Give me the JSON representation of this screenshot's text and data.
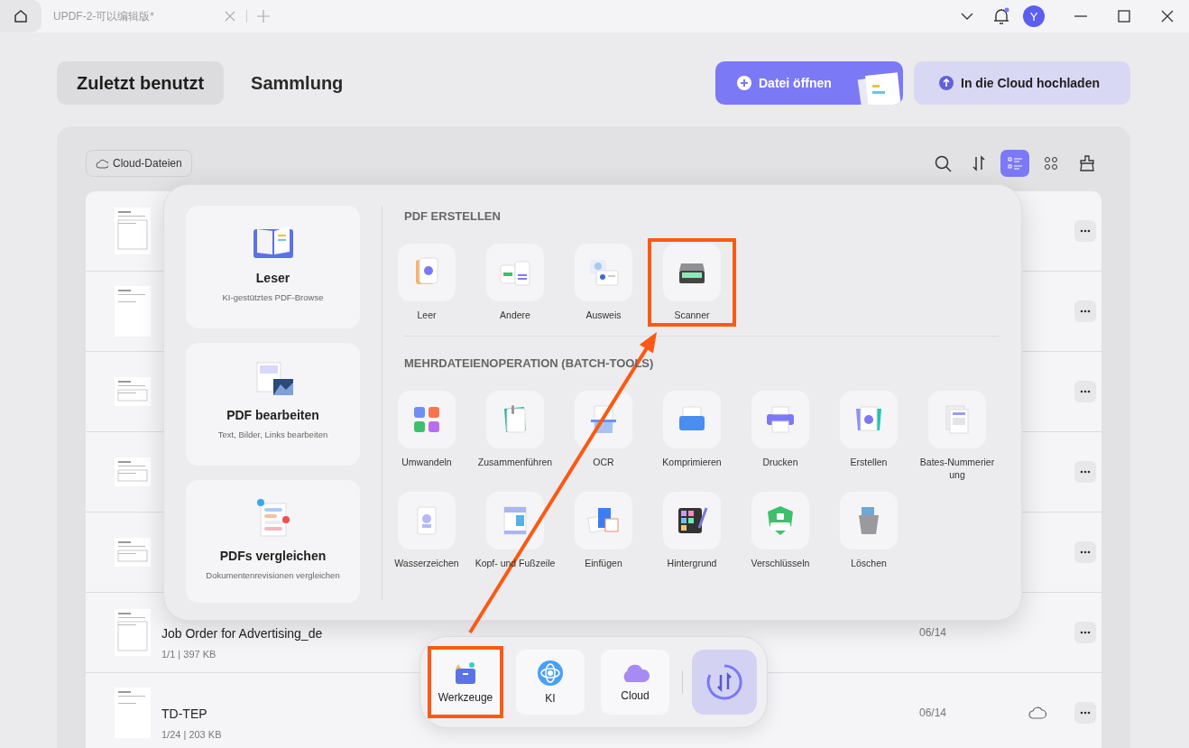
{
  "titlebar": {
    "tab_title": "UPDF-2-可以编辑版*",
    "avatar": "Y"
  },
  "view_tabs": [
    {
      "label": "Zuletzt benutzt",
      "selected": true
    },
    {
      "label": "Sammlung",
      "selected": false
    }
  ],
  "actions": {
    "open": "Datei öffnen",
    "upload": "In die Cloud hochladen"
  },
  "filter_chip": "Cloud-Dateien",
  "toolbar": [
    {
      "kind": "search",
      "selected": false
    },
    {
      "kind": "sort",
      "selected": false
    },
    {
      "kind": "list",
      "selected": true
    },
    {
      "kind": "grid",
      "selected": false
    },
    {
      "kind": "clean",
      "selected": false
    }
  ],
  "files": [
    {
      "kind": "form",
      "cloud": false
    },
    {
      "kind": "text",
      "cloud": false
    },
    {
      "kind": "table",
      "cloud": false
    },
    {
      "kind": "table",
      "cloud": false
    },
    {
      "kind": "table",
      "cloud": false
    },
    {
      "kind": "form",
      "name": "Job Order for Advertising_de",
      "meta": "1/1 | 397 KB",
      "date": "06/14",
      "cloud": false
    },
    {
      "kind": "text",
      "name": "TD-TEP",
      "meta": "1/24 | 203 KB",
      "date": "06/14",
      "cloud": true
    }
  ],
  "tools_popup": {
    "feature_cards": [
      {
        "kind": "reader",
        "title": "Leser",
        "subtitle": "KI-gestütztes PDF-Browse"
      },
      {
        "kind": "edit",
        "title": "PDF bearbeiten",
        "subtitle": "Text, Bilder, Links bearbeiten"
      },
      {
        "kind": "compare",
        "title": "PDFs vergleichen",
        "subtitle": "Dokumentenrevisionen vergleichen"
      }
    ],
    "sections": [
      {
        "title": "PDF ERSTELLEN",
        "items": [
          {
            "kind": "blank",
            "label": "Leer",
            "highlighted": false
          },
          {
            "kind": "other",
            "label": "Andere",
            "highlighted": false
          },
          {
            "kind": "id",
            "label": "Ausweis",
            "highlighted": false
          },
          {
            "kind": "scanner",
            "label": "Scanner",
            "highlighted": true
          }
        ]
      },
      {
        "title": "MEHRDATEIENOPERATION (BATCH-TOOLS)",
        "items": [
          {
            "kind": "convert",
            "label": "Umwandeln",
            "highlighted": false
          },
          {
            "kind": "merge",
            "label": "Zusammenführen",
            "highlighted": false
          },
          {
            "kind": "ocr",
            "label": "OCR",
            "highlighted": false
          },
          {
            "kind": "compress",
            "label": "Komprimieren",
            "highlighted": false
          },
          {
            "kind": "print",
            "label": "Drucken",
            "highlighted": false
          },
          {
            "kind": "create",
            "label": "Erstellen",
            "highlighted": false
          },
          {
            "kind": "bates",
            "label": "Bates-Nummerier ung",
            "highlighted": false
          },
          {
            "kind": "watermark",
            "label": "Wasserzeichen",
            "highlighted": false
          },
          {
            "kind": "header",
            "label": "Kopf- und Fußzeile",
            "highlighted": false
          },
          {
            "kind": "insert",
            "label": "Einfügen",
            "highlighted": false
          },
          {
            "kind": "background",
            "label": "Hintergrund",
            "highlighted": false
          },
          {
            "kind": "encrypt",
            "label": "Verschlüsseln",
            "highlighted": false
          },
          {
            "kind": "delete",
            "label": "Löschen",
            "highlighted": false
          }
        ]
      }
    ]
  },
  "dock": [
    {
      "kind": "tools",
      "label": "Werkzeuge",
      "highlighted": true
    },
    {
      "kind": "ai",
      "label": "KI",
      "highlighted": false
    },
    {
      "kind": "cloud",
      "label": "Cloud",
      "highlighted": false
    },
    {
      "kind": "switch",
      "highlighted": false
    }
  ]
}
